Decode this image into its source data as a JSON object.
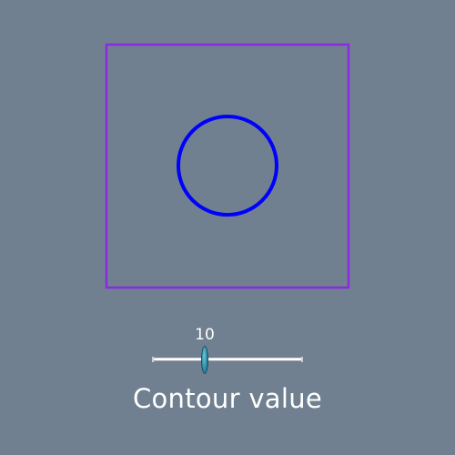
{
  "scene": {
    "background_color": "#708090",
    "outline_color": "#8a2be2",
    "contour_color": "#0000ff"
  },
  "slider": {
    "value_label": "10",
    "title": "Contour value",
    "value": 10,
    "handle_color": "#2f8fa8"
  }
}
